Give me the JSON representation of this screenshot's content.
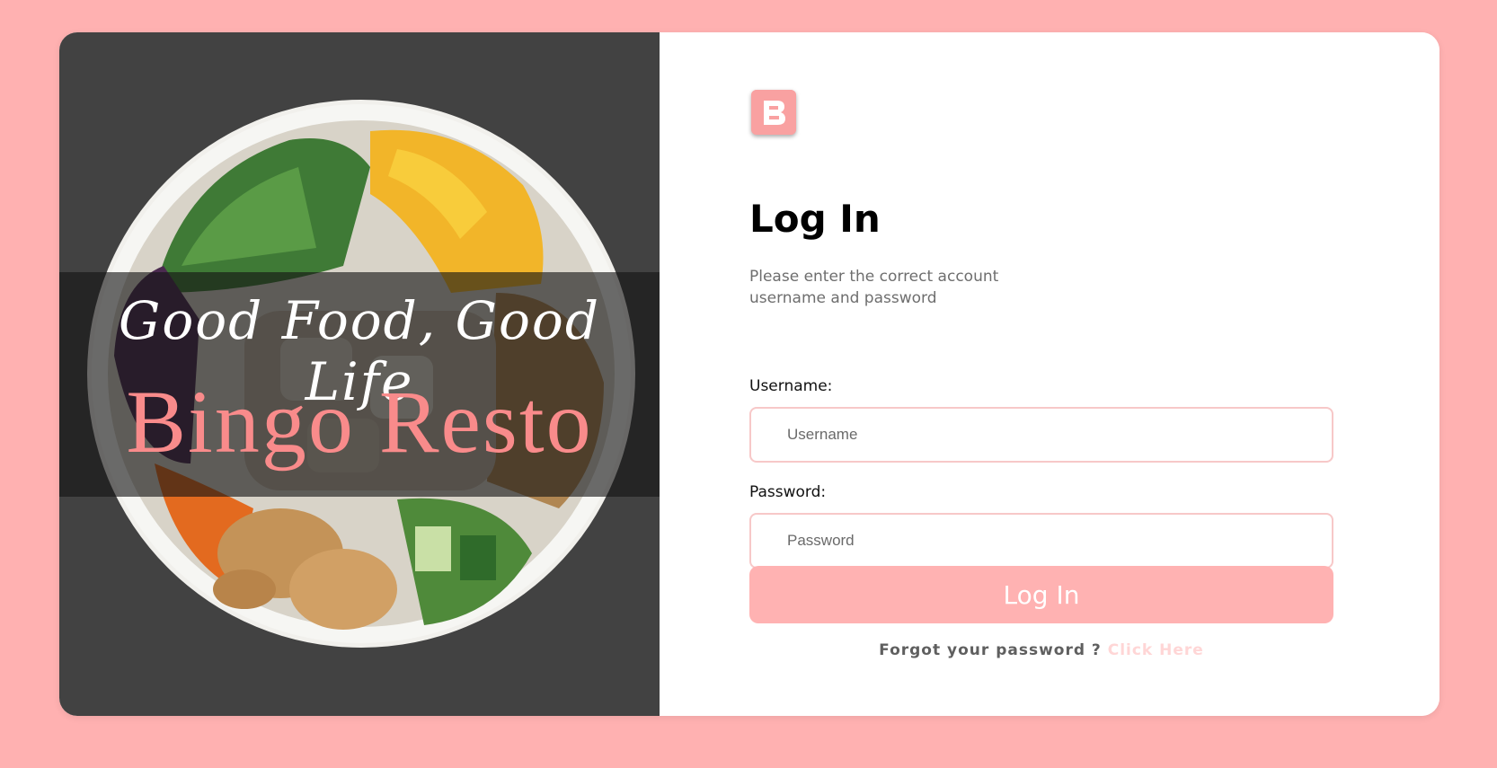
{
  "brand": {
    "tagline": "Good Food, Good Life",
    "name": "Bingo Resto",
    "logo_letter": "B"
  },
  "login": {
    "title": "Log In",
    "subtitle": "Please enter the correct account username and password",
    "username_label": "Username:",
    "username_placeholder": "Username",
    "password_label": "Password:",
    "password_placeholder": "Password",
    "submit_label": "Log In",
    "forgot_text": "Forgot your password ?",
    "forgot_link": "Click Here"
  },
  "colors": {
    "page_background": "#ffb1b1",
    "left_panel": "#424242",
    "accent": "#ffb2b2",
    "brand_text": "#f98b8b",
    "link": "#ffd6d6"
  },
  "icons": {
    "logo": "b-logo-icon",
    "hero": "salad-bowl-image"
  }
}
